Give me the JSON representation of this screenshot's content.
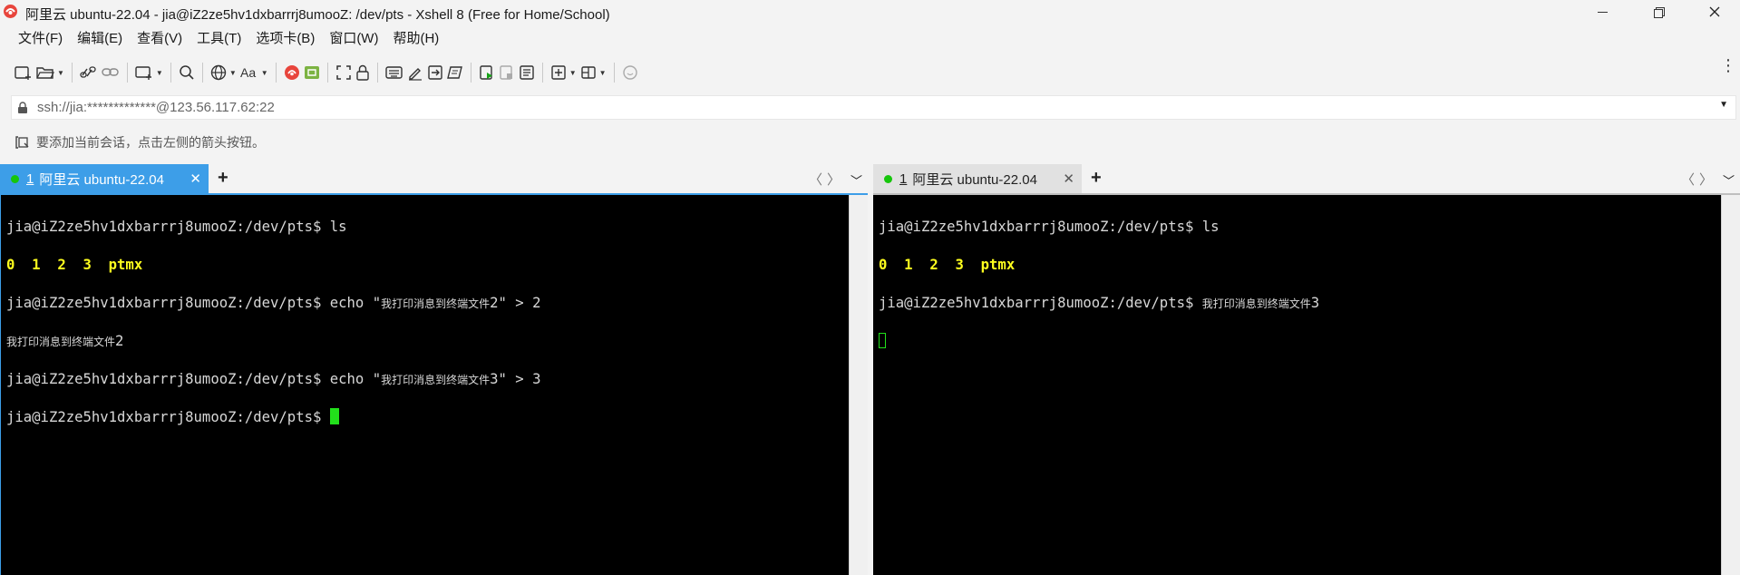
{
  "window": {
    "title": "阿里云 ubuntu-22.04 - jia@iZ2ze5hv1dxbarrrj8umooZ: /dev/pts - Xshell 8 (Free for Home/School)",
    "app_icon": "xshell-logo-icon",
    "accent_color": "#3d9ee8"
  },
  "menu": {
    "items": [
      "文件(F)",
      "编辑(E)",
      "查看(V)",
      "工具(T)",
      "选项卡(B)",
      "窗口(W)",
      "帮助(H)"
    ]
  },
  "toolbar": {
    "icons": [
      "new-session-icon",
      "open-folder-icon",
      "reconnect-icon",
      "link-icon",
      "new-window-icon",
      "search-icon",
      "globe-icon",
      "font-icon",
      "xftp-icon",
      "xmanager-icon",
      "fullscreen-icon",
      "lock-icon",
      "keyboard-icon",
      "compose-icon",
      "transfer-icon",
      "script-icon",
      "run-script-icon",
      "stop-script-icon",
      "log-icon",
      "new-tab-icon",
      "layout-icon",
      "chat-icon"
    ]
  },
  "address": {
    "value": "ssh://jia:*************@123.56.117.62:22"
  },
  "hint": {
    "text": "要添加当前会话，点击左侧的箭头按钮。"
  },
  "panes": {
    "left": {
      "tab_number": "1",
      "tab_title": "阿里云 ubuntu-22.04",
      "prompt": "jia@iZ2ze5hv1dxbarrrj8umooZ:/dev/pts$ ",
      "lines": {
        "l1_cmd": "ls",
        "l2_out": "0  1  2  3  ptmx",
        "l3_cmd_a": "echo \"",
        "l3_cmd_cjk": "我打印消息到终端文件",
        "l3_cmd_b": "2\" > 2",
        "l4_out_cjk": "我打印消息到终端文件",
        "l4_out_num": "2",
        "l5_cmd_a": "echo \"",
        "l5_cmd_cjk": "我打印消息到终端文件",
        "l5_cmd_b": "3\" > 3"
      }
    },
    "right": {
      "tab_number": "1",
      "tab_title": "阿里云 ubuntu-22.04",
      "prompt": "jia@iZ2ze5hv1dxbarrrj8umooZ:/dev/pts$ ",
      "lines": {
        "l1_cmd": "ls",
        "l2_out": "0  1  2  3  ptmx",
        "l3_out_cjk": "我打印消息到终端文件",
        "l3_out_num": "3"
      }
    }
  }
}
